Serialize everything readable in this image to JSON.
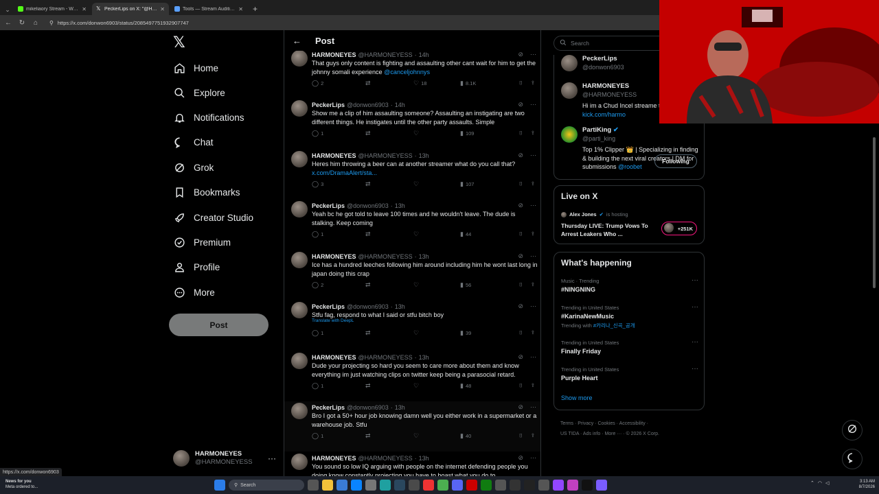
{
  "browser": {
    "tabs": [
      {
        "title": "mikeliaory Stream - Watch Li",
        "color": "#53fc18",
        "active": false
      },
      {
        "title": "PeckerLips on X: \"@HARMONEYES",
        "color": "#ffffff",
        "active": true
      },
      {
        "title": "Tools — Stream Auditing Utilities",
        "color": "#5aa0ff",
        "active": false
      }
    ],
    "url": "https://x.com/donwon6903/status/2085497751932907747"
  },
  "nav": {
    "items": [
      {
        "label": "Home",
        "icon": "home-icon"
      },
      {
        "label": "Explore",
        "icon": "search-icon"
      },
      {
        "label": "Notifications",
        "icon": "bell-icon"
      },
      {
        "label": "Chat",
        "icon": "chat-icon"
      },
      {
        "label": "Grok",
        "icon": "grok-icon"
      },
      {
        "label": "Bookmarks",
        "icon": "bookmark-icon"
      },
      {
        "label": "Creator Studio",
        "icon": "rocket-icon"
      },
      {
        "label": "Premium",
        "icon": "verified-icon"
      },
      {
        "label": "Profile",
        "icon": "person-icon"
      },
      {
        "label": "More",
        "icon": "more-circle-icon"
      }
    ],
    "post_label": "Post",
    "account": {
      "name": "HARMONEYES",
      "handle": "@HARMONEYESS"
    }
  },
  "main": {
    "title": "Post",
    "tweets": [
      {
        "name": "HARMONEYES",
        "handle": "@HARMONEYESS",
        "time": "14h",
        "text": "That guys only content is fighting and assaulting other cant wait for him to get the  johnny somali experience ",
        "link": "@canceljohnnys",
        "replies": "2",
        "reposts": "",
        "likes": "18",
        "views": "8.1K",
        "translate": ""
      },
      {
        "name": "PeckerLips",
        "handle": "@donwon6903",
        "time": "14h",
        "text": "Show me a clip of him assaulting someone? Assaulting an instigating are two different things. He instigates until the other party assaults. Simple",
        "link": "",
        "replies": "1",
        "reposts": "",
        "likes": "",
        "views": "109",
        "translate": ""
      },
      {
        "name": "HARMONEYES",
        "handle": "@HARMONEYESS",
        "time": "13h",
        "text": "Heres him throwing a beer can at another streamer what do you call that? ",
        "link": "x.com/DramaAlert/sta...",
        "replies": "3",
        "reposts": "",
        "likes": "",
        "views": "107",
        "translate": ""
      },
      {
        "name": "PeckerLips",
        "handle": "@donwon6903",
        "time": "13h",
        "text": "Yeah bc he got told to leave 100 times and he wouldn't leave. The dude is stalking. Keep coming",
        "link": "",
        "replies": "1",
        "reposts": "",
        "likes": "",
        "views": "44",
        "translate": ""
      },
      {
        "name": "HARMONEYES",
        "handle": "@HARMONEYESS",
        "time": "13h",
        "text": "Ice has a hundred leeches following him around including him he wont last long in japan doing this crap",
        "link": "",
        "replies": "2",
        "reposts": "",
        "likes": "",
        "views": "56",
        "translate": ""
      },
      {
        "name": "PeckerLips",
        "handle": "@donwon6903",
        "time": "13h",
        "text": "Stfu fag, respond to what I said or stfu bitch boy",
        "link": "",
        "replies": "1",
        "reposts": "",
        "likes": "",
        "views": "39",
        "translate": "Translate with DeepL"
      },
      {
        "name": "HARMONEYES",
        "handle": "@HARMONEYESS",
        "time": "13h",
        "text": "Dude your projecting so hard you seem to care more about them and know everything im just watching clips on twitter keep being a parasocial retard.",
        "link": "",
        "replies": "1",
        "reposts": "",
        "likes": "",
        "views": "48",
        "translate": ""
      },
      {
        "name": "PeckerLips",
        "handle": "@donwon6903",
        "time": "13h",
        "text": "Bro I got a 50+ hour job knowing damn well you either work in a supermarket or a warehouse job. Stfu",
        "link": "",
        "replies": "1",
        "reposts": "",
        "likes": "",
        "views": "40",
        "translate": ""
      },
      {
        "name": "HARMONEYES",
        "handle": "@HARMONEYESS",
        "time": "13h",
        "text": "You sound so low IQ arguing with people on the internet defending people you doing know constantly projecting you have to boast what you do to",
        "link": "",
        "replies": "",
        "reposts": "",
        "likes": "",
        "views": "",
        "translate": ""
      }
    ]
  },
  "sidebar": {
    "search_placeholder": "Search",
    "relevant": [
      {
        "name": "PeckerLips",
        "handle": "@donwon6903",
        "bio": "",
        "link": ""
      },
      {
        "name": "HARMONEYES",
        "handle": "@HARMONEYESS",
        "bio": "Hi im a Chud Incel streame to my Life ",
        "link": "kick.com/harmo"
      },
      {
        "name": "PartiKing",
        "handle": "@parti_king",
        "bio": "Top 1% Clipper 👑 | Specializing in finding & building the next viral creators | DM for submissions ",
        "link": "@roobet"
      }
    ],
    "following_label": "Following",
    "live": {
      "title": "Live on X",
      "host_name": "Alex Jones",
      "host_suffix": "is hosting",
      "stream_title": "Thursday LIVE: Trump Vows To Arrest Leakers Who ...",
      "count": "+251K"
    },
    "happening": {
      "title": "What's happening",
      "trends": [
        {
          "meta": "Music · Trending",
          "name": "#NINGNING",
          "with_label": "",
          "with_tag": ""
        },
        {
          "meta": "Trending in United States",
          "name": "#KarinaNewMusic",
          "with_label": "Trending with ",
          "with_tag": "#카리나_신곡_공개"
        },
        {
          "meta": "Trending in United States",
          "name": "Finally Friday",
          "with_label": "",
          "with_tag": ""
        },
        {
          "meta": "Trending in United States",
          "name": "Purple Heart",
          "with_label": "",
          "with_tag": ""
        }
      ],
      "show_more": "Show more"
    },
    "footer": {
      "line1": "Terms  ·  Privacy  ·  Cookies  ·  Accessibility  ·",
      "line2": "US TIDA  ·  Ads info  ·  More ···  ·  © 2026 X Corp."
    }
  },
  "status_url": "https://x.com/donwon6903",
  "taskbar": {
    "weather_title": "News for you",
    "weather_sub": "Meta ordered to...",
    "search_label": "Search",
    "time": "3:13 AM",
    "date": "8/7/2026"
  },
  "colors": {
    "accent": "#1d9bf0",
    "live": "#f91880",
    "background": "#000000"
  }
}
